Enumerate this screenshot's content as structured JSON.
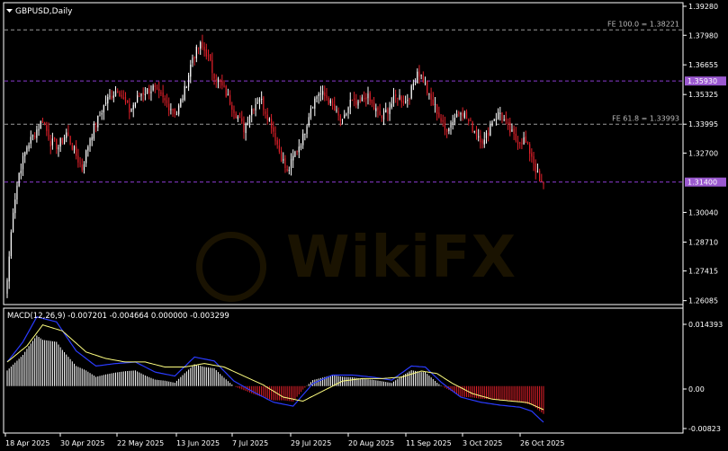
{
  "window": {
    "title": "GBPUSD,Daily",
    "dropdown_icon": "triangle-down-icon"
  },
  "colors": {
    "background": "#000000",
    "frame": "#ffffff",
    "bull": "#ffffff",
    "bear": "#e0202a",
    "macd_line": "#2a3bff",
    "signal_line": "#ffff80",
    "fib_line": "#9a9a9a",
    "level_line": "#8a3bd0",
    "label_bg": "#9b59d0",
    "watermark": "#b8860b"
  },
  "watermark": {
    "text": "WikiFX"
  },
  "price_panel": {
    "axis_labels": [
      "1.39280",
      "1.37980",
      "1.36655",
      "1.35325",
      "1.33995",
      "1.32700",
      "1.30040",
      "1.28710",
      "1.27415",
      "1.26085"
    ],
    "fib_levels": [
      {
        "label": "FE 100.0 = 1.38221",
        "price": 1.38221
      },
      {
        "label": "FE 61.8 = 1.33993",
        "price": 1.33993
      }
    ],
    "level_lines": [
      {
        "price": 1.3593,
        "label": "1.35930"
      },
      {
        "price": 1.314,
        "label": "1.31400"
      }
    ]
  },
  "macd_panel": {
    "header": "MACD(12,26,9) -0.007201 -0.004664 0.000000 -0.003299",
    "axis_labels": [
      "0.014393",
      "0.00",
      "-0.00823"
    ]
  },
  "time_axis": [
    "18 Apr 2025",
    "30 Apr 2025",
    "22 May 2025",
    "13 Jun 2025",
    "7 Jul 2025",
    "29 Jul 2025",
    "20 Aug 2025",
    "11 Sep 2025",
    "3 Oct 2025",
    "26 Oct 2025"
  ],
  "chart_data": {
    "type": "candlestick",
    "symbol": "GBPUSD",
    "timeframe": "Daily",
    "ylim": [
      1.2595,
      1.394
    ],
    "anchor_closes": [
      [
        0,
        1.27
      ],
      [
        3,
        1.302
      ],
      [
        6,
        1.318
      ],
      [
        10,
        1.33
      ],
      [
        14,
        1.336
      ],
      [
        18,
        1.342
      ],
      [
        22,
        1.332
      ],
      [
        26,
        1.33
      ],
      [
        30,
        1.336
      ],
      [
        34,
        1.328
      ],
      [
        38,
        1.32
      ],
      [
        42,
        1.334
      ],
      [
        46,
        1.342
      ],
      [
        50,
        1.35
      ],
      [
        56,
        1.356
      ],
      [
        62,
        1.346
      ],
      [
        68,
        1.354
      ],
      [
        74,
        1.356
      ],
      [
        80,
        1.35
      ],
      [
        86,
        1.345
      ],
      [
        90,
        1.355
      ],
      [
        94,
        1.37
      ],
      [
        98,
        1.375
      ],
      [
        101,
        1.372
      ],
      [
        104,
        1.364
      ],
      [
        108,
        1.358
      ],
      [
        112,
        1.352
      ],
      [
        116,
        1.345
      ],
      [
        120,
        1.338
      ],
      [
        124,
        1.347
      ],
      [
        128,
        1.352
      ],
      [
        134,
        1.34
      ],
      [
        138,
        1.328
      ],
      [
        142,
        1.318
      ],
      [
        146,
        1.327
      ],
      [
        150,
        1.334
      ],
      [
        154,
        1.348
      ],
      [
        158,
        1.354
      ],
      [
        162,
        1.352
      ],
      [
        166,
        1.346
      ],
      [
        170,
        1.34
      ],
      [
        174,
        1.35
      ],
      [
        178,
        1.348
      ],
      [
        182,
        1.353
      ],
      [
        186,
        1.347
      ],
      [
        190,
        1.343
      ],
      [
        194,
        1.348
      ],
      [
        198,
        1.353
      ],
      [
        202,
        1.35
      ],
      [
        205,
        1.355
      ],
      [
        208,
        1.364
      ],
      [
        211,
        1.36
      ],
      [
        214,
        1.352
      ],
      [
        218,
        1.346
      ],
      [
        222,
        1.337
      ],
      [
        226,
        1.342
      ],
      [
        230,
        1.347
      ],
      [
        234,
        1.341
      ],
      [
        238,
        1.336
      ],
      [
        242,
        1.332
      ],
      [
        246,
        1.342
      ],
      [
        250,
        1.345
      ],
      [
        254,
        1.338
      ],
      [
        258,
        1.333
      ],
      [
        262,
        1.333
      ],
      [
        266,
        1.326
      ],
      [
        270,
        1.314
      ],
      [
        272,
        1.312
      ]
    ],
    "macd_anchors": [
      [
        0,
        0.0048
      ],
      [
        8,
        0.0088
      ],
      [
        15,
        0.0138
      ],
      [
        25,
        0.0128
      ],
      [
        35,
        0.007
      ],
      [
        45,
        0.004
      ],
      [
        55,
        0.0045
      ],
      [
        65,
        0.0048
      ],
      [
        75,
        0.0028
      ],
      [
        85,
        0.002
      ],
      [
        95,
        0.0058
      ],
      [
        105,
        0.005
      ],
      [
        115,
        0.001
      ],
      [
        125,
        -0.0012
      ],
      [
        135,
        -0.0032
      ],
      [
        145,
        -0.004
      ],
      [
        155,
        0.0005
      ],
      [
        165,
        0.0022
      ],
      [
        175,
        0.0022
      ],
      [
        185,
        0.0018
      ],
      [
        195,
        0.0012
      ],
      [
        205,
        0.004
      ],
      [
        212,
        0.0038
      ],
      [
        220,
        0.0008
      ],
      [
        230,
        -0.0022
      ],
      [
        240,
        -0.0032
      ],
      [
        250,
        -0.0038
      ],
      [
        260,
        -0.0042
      ],
      [
        266,
        -0.005
      ],
      [
        272,
        -0.0072
      ]
    ],
    "signal_anchors": [
      [
        0,
        0.0048
      ],
      [
        10,
        0.008
      ],
      [
        18,
        0.0122
      ],
      [
        28,
        0.011
      ],
      [
        40,
        0.0068
      ],
      [
        50,
        0.0055
      ],
      [
        60,
        0.0048
      ],
      [
        70,
        0.0048
      ],
      [
        80,
        0.0038
      ],
      [
        90,
        0.0038
      ],
      [
        100,
        0.0045
      ],
      [
        110,
        0.0038
      ],
      [
        120,
        0.002
      ],
      [
        130,
        0.0002
      ],
      [
        140,
        -0.0022
      ],
      [
        150,
        -0.003
      ],
      [
        160,
        -0.001
      ],
      [
        170,
        0.001
      ],
      [
        180,
        0.0015
      ],
      [
        190,
        0.0015
      ],
      [
        200,
        0.0018
      ],
      [
        210,
        0.003
      ],
      [
        218,
        0.0025
      ],
      [
        226,
        0.0005
      ],
      [
        236,
        -0.0015
      ],
      [
        246,
        -0.0026
      ],
      [
        256,
        -0.003
      ],
      [
        264,
        -0.0033
      ],
      [
        272,
        -0.0047
      ]
    ],
    "macd_ylim": [
      -0.009,
      0.015
    ]
  }
}
